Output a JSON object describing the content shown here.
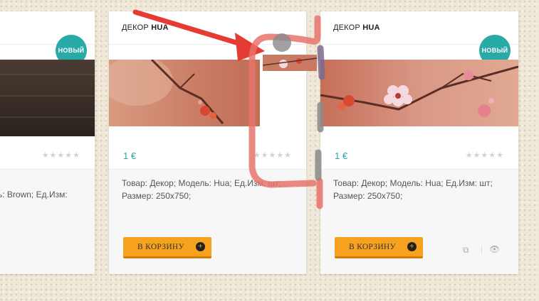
{
  "cards": [
    {
      "badge": "НОВЫЙ",
      "stars": "★★★★★",
      "desc": "ль: Brown; Ед.Изм:"
    },
    {
      "title_prefix": "ДЕКОР ",
      "title_name": "HUA",
      "price": "1 €",
      "stars": "★★★★★",
      "desc": "Товар: Декор; Модель: Hua; Ед.Изм: шт; Размер: 250x750;",
      "cart_label": "В КОРЗИНУ"
    },
    {
      "title_prefix": "ДЕКОР ",
      "title_name": "HUA",
      "badge": "НОВЫЙ",
      "price": "1 €",
      "stars": "★★★★★",
      "desc": "Товар: Декор; Модель: Hua; Ед.Изм: шт; Размер: 250x750;",
      "cart_label": "В КОРЗИНУ",
      "compare_icon": "compare-icon",
      "view_icon": "eye-icon"
    }
  ],
  "icons": {
    "plus": "+",
    "compare": "⧉",
    "eye": "👁"
  },
  "colors": {
    "accent": "#29aaa7",
    "price": "#2aa3a8",
    "button": "#f6a21e",
    "annotation_red": "#e53b32"
  }
}
